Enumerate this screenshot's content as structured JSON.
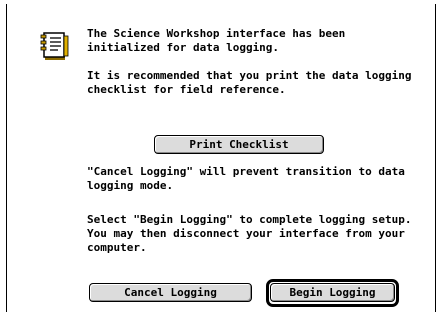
{
  "dialog": {
    "icon": "document-checklist-icon",
    "message_1": "The Science Workshop interface has been initialized for data logging.",
    "message_2": "It is recommended that you print the data logging checklist for field reference.",
    "message_3": "\"Cancel Logging\" will prevent transition to data logging mode.",
    "message_4": "Select \"Begin Logging\" to complete logging setup. You may then disconnect your interface from your computer."
  },
  "buttons": {
    "print_checklist": "Print Checklist",
    "cancel_logging": "Cancel Logging",
    "begin_logging": "Begin Logging"
  }
}
